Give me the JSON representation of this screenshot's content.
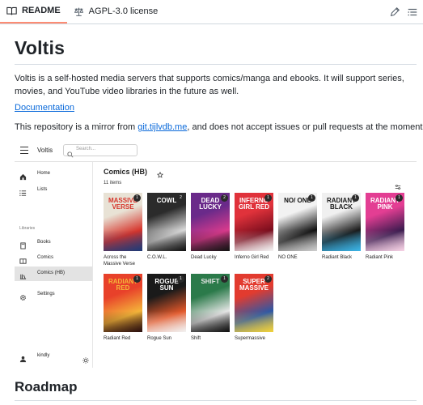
{
  "tabs": [
    {
      "label": "README",
      "icon": "book-icon",
      "active": true
    },
    {
      "label": "AGPL-3.0 license",
      "icon": "scale-icon",
      "active": false
    }
  ],
  "readme": {
    "title": "Voltis",
    "description": "Voltis is a self-hosted media servers that supports comics/manga and ebooks. It will support series, movies, and YouTube video libraries in the future as well.",
    "doc_link": "Documentation",
    "mirror_prefix": "This repository is a mirror from ",
    "mirror_link": "git.tijlvdb.me",
    "mirror_suffix": ", and does not accept issues or pull requests at the moment.",
    "next_heading": "Roadmap"
  },
  "app": {
    "name": "Voltis",
    "search_placeholder": "Search...",
    "nav": [
      {
        "label": "Home",
        "icon": "home-icon"
      },
      {
        "label": "Lists",
        "icon": "list-icon"
      }
    ],
    "libraries_heading": "Libraries",
    "libraries": [
      {
        "label": "Books",
        "icon": "book-icon",
        "active": false
      },
      {
        "label": "Comics",
        "icon": "comic-icon",
        "active": false
      },
      {
        "label": "Comics (HB)",
        "icon": "library-icon",
        "active": true
      },
      {
        "label": "Settings",
        "icon": "gear-icon",
        "active": false
      }
    ],
    "user": {
      "name": "kindly",
      "icon": "person-icon"
    },
    "collection_title": "Comics (HB)",
    "item_count": "11 items",
    "items": [
      {
        "title": "Across the Massive Verse",
        "count": "1",
        "colors": [
          "#e8e2d5",
          "#d6342b",
          "#1e3a78"
        ],
        "cover_text": "MASSIVE VERSE"
      },
      {
        "title": "C.O.W.L.",
        "count": "2",
        "colors": [
          "#2b2b2b",
          "#d9d9d9",
          "#111111"
        ],
        "cover_text": "COWL"
      },
      {
        "title": "Dead Lucky",
        "count": "2",
        "colors": [
          "#6a2a8a",
          "#d83a8c",
          "#141414"
        ],
        "cover_text": "DEAD LUCKY"
      },
      {
        "title": "Inferno Girl Red",
        "count": "1",
        "colors": [
          "#e0323b",
          "#7a0d1d",
          "#f4f4f4"
        ],
        "cover_text": "INFERNO GIRL RED"
      },
      {
        "title": "NO ONE",
        "count": "1",
        "colors": [
          "#f2f2f2",
          "#101010",
          "#cfcfcf"
        ],
        "cover_text": "NO/ ONE"
      },
      {
        "title": "Radiant Black",
        "count": "1",
        "colors": [
          "#f0f0f0",
          "#1a1a1a",
          "#3bb5e8"
        ],
        "cover_text": "RADIANT BLACK"
      },
      {
        "title": "Radiant Pink",
        "count": "1",
        "colors": [
          "#e33e93",
          "#3b1b4f",
          "#f8d3e6"
        ],
        "cover_text": "RADIANT PINK"
      },
      {
        "title": "Radiant Red",
        "count": "1",
        "colors": [
          "#e8412a",
          "#f4b53a",
          "#2a0e0e"
        ],
        "cover_text": "RADIANT RED"
      },
      {
        "title": "Rogue Sun",
        "count": "1",
        "colors": [
          "#1a1a1a",
          "#e2582a",
          "#f2f2f2"
        ],
        "cover_text": "ROGUE SUN"
      },
      {
        "title": "Shift",
        "count": "1",
        "colors": [
          "#2b7a4a",
          "#e6e6e6",
          "#0f0f0f"
        ],
        "cover_text": "SHIFT"
      },
      {
        "title": "Supermassive",
        "count": "2",
        "colors": [
          "#e23b2f",
          "#2d58a6",
          "#f2d23a"
        ],
        "cover_text": "SUPER MASSIVE"
      }
    ]
  },
  "colors": {
    "link": "#0969da",
    "tab_accent": "#fd8c73",
    "rule": "#d8dee4"
  }
}
